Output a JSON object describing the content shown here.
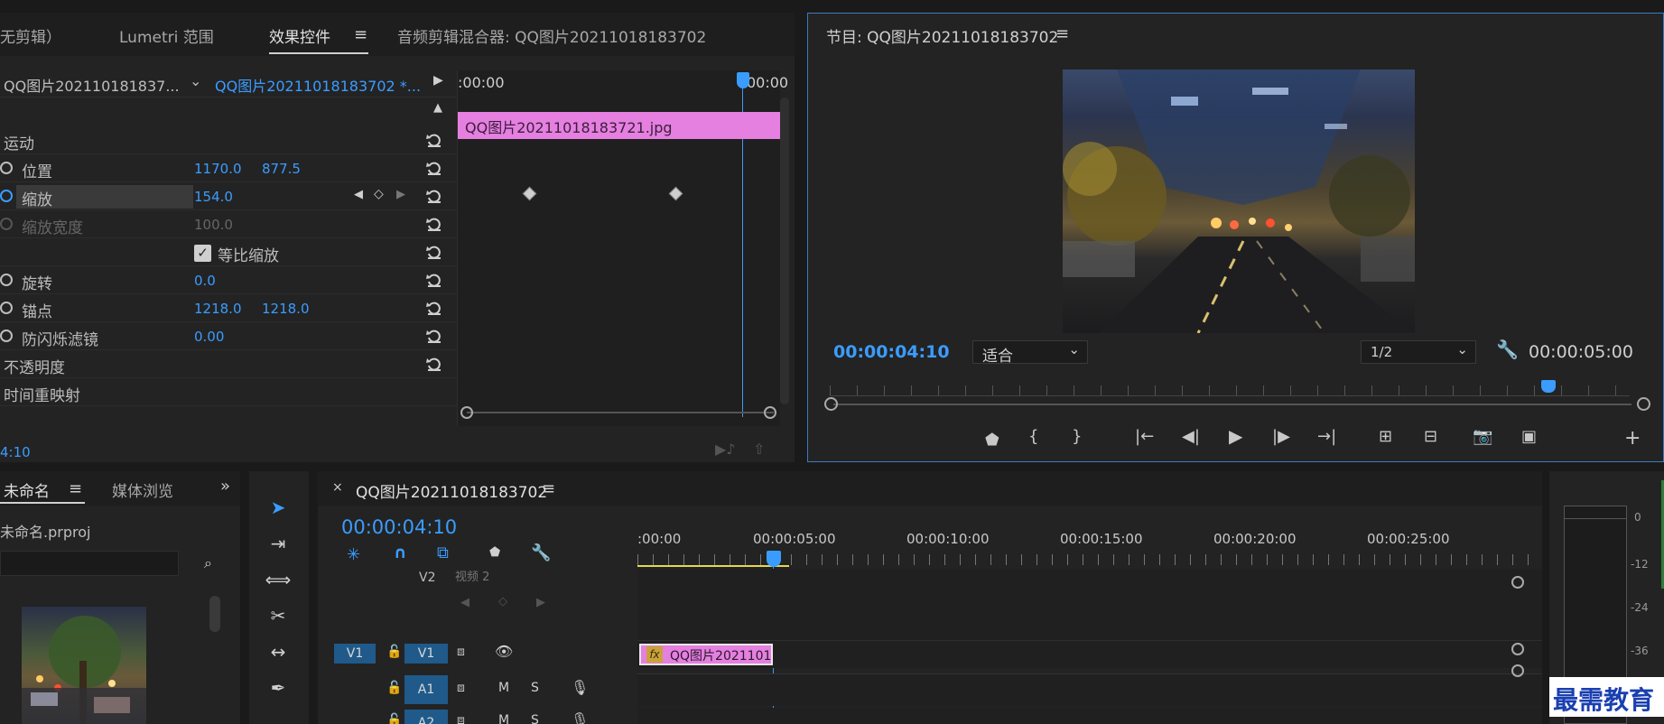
{
  "effect_panel": {
    "tabs": [
      "无剪辑）",
      "Lumetri 范围",
      "效果控件",
      "音频剪辑混合器: QQ图片20211018183702"
    ],
    "menu_icon": "hamburger-icon",
    "source_clip": "QQ图片202110181837...",
    "sequence_clip": "QQ图片20211018183702 *...",
    "ruler_start": ":00:00",
    "ruler_end": "00:00",
    "clip_bar_label": "QQ图片20211018183721.jpg",
    "clip_bar_color": "#e57fe0",
    "timecode": "4:10",
    "rows": {
      "motion": "运动",
      "position": {
        "label": "位置",
        "x": "1170.0",
        "y": "877.5"
      },
      "scale": {
        "label": "缩放",
        "value": "154.0"
      },
      "scale_width": {
        "label": "缩放宽度",
        "value": "100.0"
      },
      "uniform_scale": {
        "label": "等比缩放"
      },
      "rotation": {
        "label": "旋转",
        "value": "0.0"
      },
      "anchor": {
        "label": "锚点",
        "x": "1218.0",
        "y": "1218.0"
      },
      "anti_flicker": {
        "label": "防闪烁滤镜",
        "value": "0.00"
      },
      "opacity": "不透明度",
      "time_remap": "时间重映射"
    }
  },
  "program_monitor": {
    "title": "节目: QQ图片20211018183702",
    "current_time": "00:00:04:10",
    "fit_option": "适合",
    "resolution": "1/2",
    "duration": "00:00:05:00"
  },
  "project_panel": {
    "tabs": [
      "未命名",
      "媒体浏览"
    ],
    "expand_icon": "double-chevron-right-icon",
    "project_file": "未命名.prproj"
  },
  "timeline": {
    "title": "QQ图片20211018183702",
    "current_time": "00:00:04:10",
    "ruler_labels": [
      ":00:00",
      "00:00:05:00",
      "00:00:10:00",
      "00:00:15:00",
      "00:00:20:00",
      "00:00:25:00"
    ],
    "v2_label": "V2",
    "v2_name": "视频 2",
    "v1_source": "V1",
    "v1_label": "V1",
    "a1_label": "A1",
    "a2_label": "A2",
    "mute": "M",
    "solo": "S",
    "clip_label": "QQ图片2021101",
    "clip_fx": "fx"
  },
  "meter": {
    "labels": [
      "0",
      "-12",
      "-24",
      "-36"
    ]
  },
  "watermark": "最需教育"
}
